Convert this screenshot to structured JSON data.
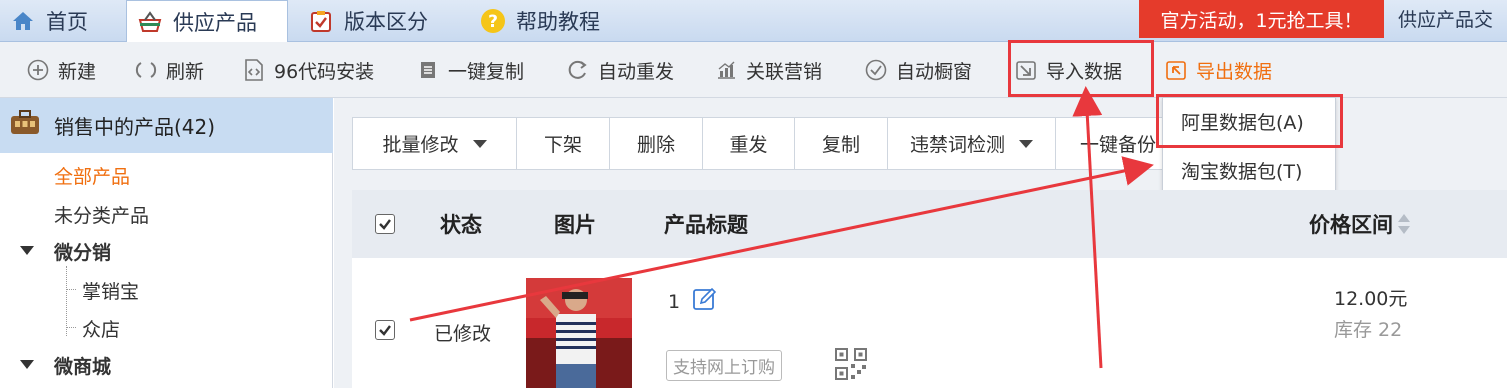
{
  "tabs": [
    {
      "label": "首页",
      "icon": "home-icon"
    },
    {
      "label": "供应产品",
      "icon": "basket-icon",
      "active": true
    },
    {
      "label": "版本区分",
      "icon": "clipboard-check-icon"
    },
    {
      "label": "帮助教程",
      "icon": "help-icon"
    }
  ],
  "promo": {
    "label": "官方活动，1元抢工具！",
    "after": "供应产品交"
  },
  "toolbar": {
    "new": "新建",
    "refresh": "刷新",
    "code_install": "96代码安装",
    "copy_all": "一键复制",
    "auto_repost": "自动重发",
    "related_marketing": "关联营销",
    "auto_window": "自动橱窗",
    "import_data": "导入数据",
    "export_data": "导出数据"
  },
  "sidebar": {
    "header": "销售中的产品(42)",
    "all_products": "全部产品",
    "uncategorized": "未分类产品",
    "micro_dist": "微分销",
    "zhangxiaobao": "掌销宝",
    "zhongdian": "众店",
    "micro_mall": "微商城"
  },
  "actions": {
    "batch_edit": "批量修改",
    "delist": "下架",
    "delete": "删除",
    "repost": "重发",
    "copy": "复制",
    "forbidden_check": "违禁词检测",
    "one_click_backup": "一键备份"
  },
  "import_menu": {
    "ali": "阿里数据包(A)",
    "taobao": "淘宝数据包(T)"
  },
  "table": {
    "headers": {
      "status": "状态",
      "image": "图片",
      "title": "产品标题",
      "price": "价格区间"
    },
    "rows": [
      {
        "status": "已修改",
        "title": "1",
        "badge": "支持网上订购",
        "price": "12.00元",
        "stock": "库存 22"
      }
    ]
  },
  "colors": {
    "accent_orange": "#f06f10",
    "highlight_red": "#e8383d",
    "promo_red": "#e53b2b"
  }
}
